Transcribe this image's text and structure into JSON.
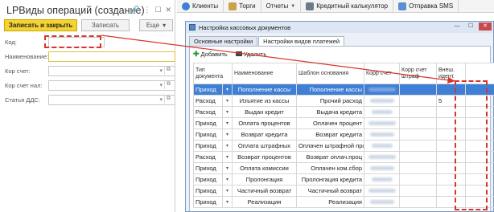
{
  "form": {
    "title": "LPВиды операций (создание)",
    "save_close_label": "Записать и закрыть",
    "save_label": "Записать",
    "more_label": "Еще",
    "fields": {
      "code_label": "Код:",
      "name_label": "Наименование:",
      "debit_label": "Кор счет:",
      "debit_vat_label": "Кор счет нал:",
      "dds_label": "Статья ДДС:"
    }
  },
  "taskbar": {
    "items": [
      {
        "label": "Клиенты",
        "icon": "clients-icon"
      },
      {
        "label": "Торги",
        "icon": "hammer-icon"
      },
      {
        "label": "Отчеты",
        "icon": "reports-icon"
      },
      {
        "label": "Кредитный калькулятор",
        "icon": "calculator-icon"
      },
      {
        "label": "Отправка SMS",
        "icon": "sms-icon"
      }
    ]
  },
  "dialog": {
    "title": "Настройка кассовых документов",
    "tabs": [
      "Основные настройки",
      "Настройки видов платежей"
    ],
    "active_tab": 1,
    "toolbar": {
      "add_label": "Добавить",
      "delete_label": "Удалить"
    },
    "columns": [
      "Тип документа",
      "Наименование",
      "Шаблон основания",
      "Корр счет",
      "Корр счет штраф",
      "Внеш. идент."
    ],
    "rows": [
      {
        "type": "Приход",
        "name": "Пополнение кассы",
        "template": "Пополнение кассы",
        "ext": "",
        "selected": true
      },
      {
        "type": "Расход",
        "name": "Изъятие из кассы",
        "template": "Прочий расход",
        "ext": "5",
        "selected": false
      },
      {
        "type": "Расход",
        "name": "Выдан кредит",
        "template": "Выдача кредита",
        "ext": "",
        "selected": false
      },
      {
        "type": "Приход",
        "name": "Оплата процентов",
        "template": "Оплачен процент",
        "ext": "",
        "selected": false
      },
      {
        "type": "Приход",
        "name": "Возврат кредита",
        "template": "Возврат кредита",
        "ext": "",
        "selected": false
      },
      {
        "type": "Приход",
        "name": "Оплата штрафных",
        "template": "Оплачен штрафной процент",
        "ext": "",
        "selected": false
      },
      {
        "type": "Расход",
        "name": "Возврат процентов",
        "template": "Возврат оплач.проц",
        "ext": "",
        "selected": false
      },
      {
        "type": "Приход",
        "name": "Оплата комиссии",
        "template": "Оплачен ком.сбор",
        "ext": "",
        "selected": false
      },
      {
        "type": "Приход",
        "name": "Пролонгация",
        "template": "Пролонгация кредита",
        "ext": "",
        "selected": false
      },
      {
        "type": "Приход",
        "name": "Частичный возврат",
        "template": "Частичный возврат",
        "ext": "",
        "selected": false
      },
      {
        "type": "Приход",
        "name": "Реализация",
        "template": "Реализация",
        "ext": "",
        "selected": false
      }
    ]
  },
  "colors": {
    "accent_yellow": "#f5d431",
    "annotation_red": "#d9342b",
    "selection_blue": "#3f7fd6"
  }
}
